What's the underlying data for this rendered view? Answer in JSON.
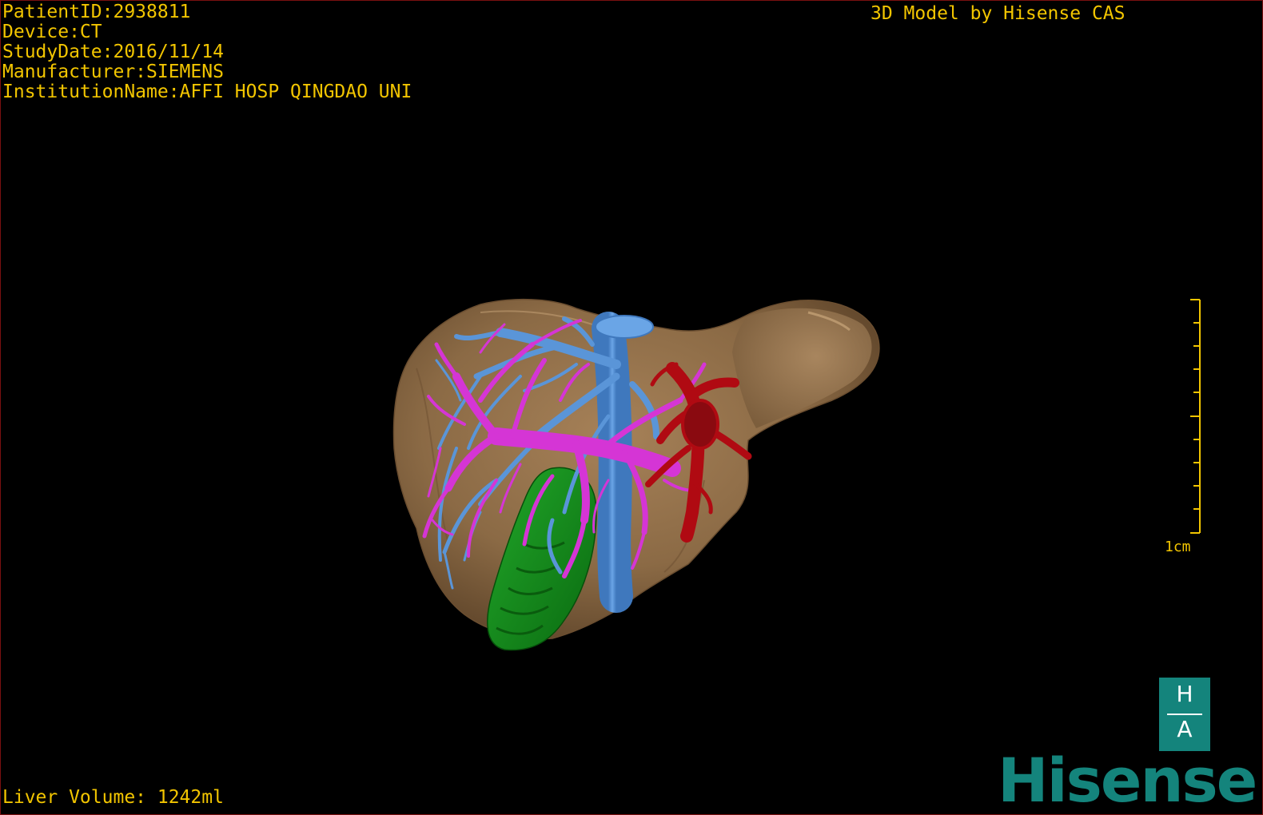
{
  "patient_info": {
    "patient_id": "PatientID:2938811",
    "device": "Device:CT",
    "study_date": "StudyDate:2016/11/14",
    "manufacturer": "Manufacturer:SIEMENS",
    "institution": "InstitutionName:AFFI HOSP QINGDAO UNI"
  },
  "credit": "3D Model by Hisense CAS",
  "liver_volume": "Liver Volume: 1242ml",
  "scale_bar": {
    "label": "1cm"
  },
  "logo": {
    "box_top": "H",
    "box_bottom": "A",
    "brand": "Hisense"
  },
  "colors": {
    "text": "#f2c500",
    "liver": "#8b6a45",
    "portal_vein": "#d535d5",
    "hepatic_vein": "#5a95d8",
    "artery": "#b00a12",
    "gallbladder": "#0f8a15",
    "brand": "#14847c"
  },
  "structures": [
    "liver",
    "portal-vein",
    "hepatic-vein",
    "hepatic-artery",
    "gallbladder"
  ]
}
